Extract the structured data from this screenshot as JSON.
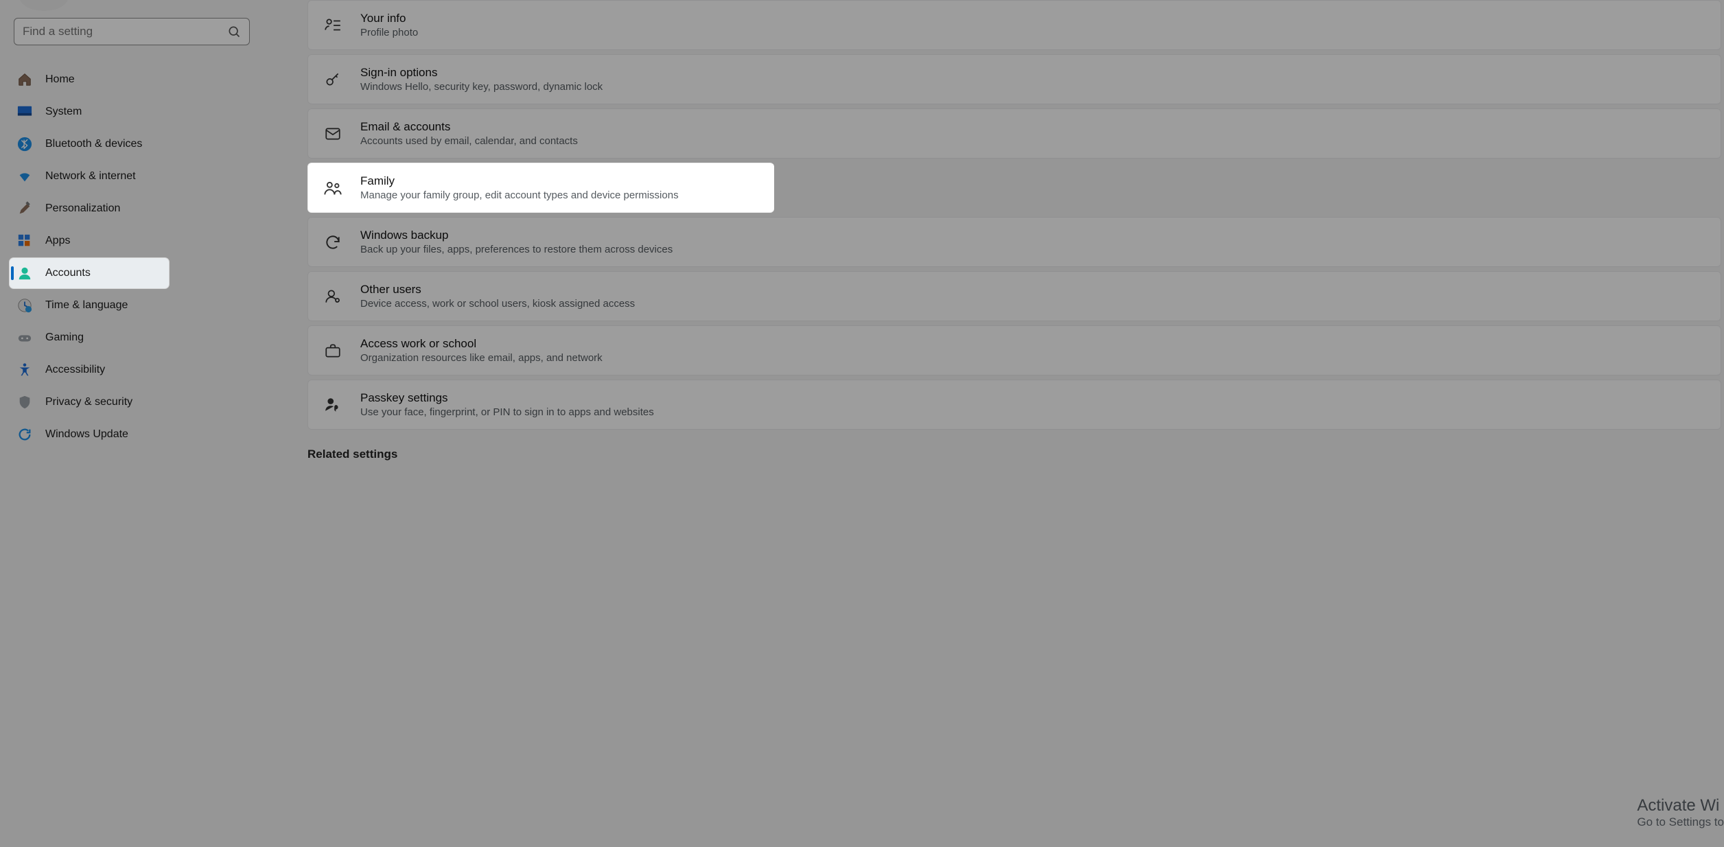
{
  "search": {
    "placeholder": "Find a setting"
  },
  "sidebar": {
    "items": [
      {
        "id": "home",
        "label": "Home"
      },
      {
        "id": "system",
        "label": "System"
      },
      {
        "id": "bluetooth",
        "label": "Bluetooth & devices"
      },
      {
        "id": "network",
        "label": "Network & internet"
      },
      {
        "id": "personal",
        "label": "Personalization"
      },
      {
        "id": "apps",
        "label": "Apps"
      },
      {
        "id": "accounts",
        "label": "Accounts"
      },
      {
        "id": "time",
        "label": "Time & language"
      },
      {
        "id": "gaming",
        "label": "Gaming"
      },
      {
        "id": "access",
        "label": "Accessibility"
      },
      {
        "id": "privacy",
        "label": "Privacy & security"
      },
      {
        "id": "update",
        "label": "Windows Update"
      }
    ]
  },
  "cards": {
    "yourinfo": {
      "title": "Your info",
      "sub": "Profile photo"
    },
    "signin": {
      "title": "Sign-in options",
      "sub": "Windows Hello, security key, password, dynamic lock"
    },
    "email": {
      "title": "Email & accounts",
      "sub": "Accounts used by email, calendar, and contacts"
    },
    "family": {
      "title": "Family",
      "sub": "Manage your family group, edit account types and device permissions"
    },
    "backup": {
      "title": "Windows backup",
      "sub": "Back up your files, apps, preferences to restore them across devices"
    },
    "other": {
      "title": "Other users",
      "sub": "Device access, work or school users, kiosk assigned access"
    },
    "work": {
      "title": "Access work or school",
      "sub": "Organization resources like email, apps, and network"
    },
    "passkey": {
      "title": "Passkey settings",
      "sub": "Use your face, fingerprint, or PIN to sign in to apps and websites"
    }
  },
  "related_heading": "Related settings",
  "watermark": {
    "l1": "Activate Wi",
    "l2": "Go to Settings to"
  }
}
